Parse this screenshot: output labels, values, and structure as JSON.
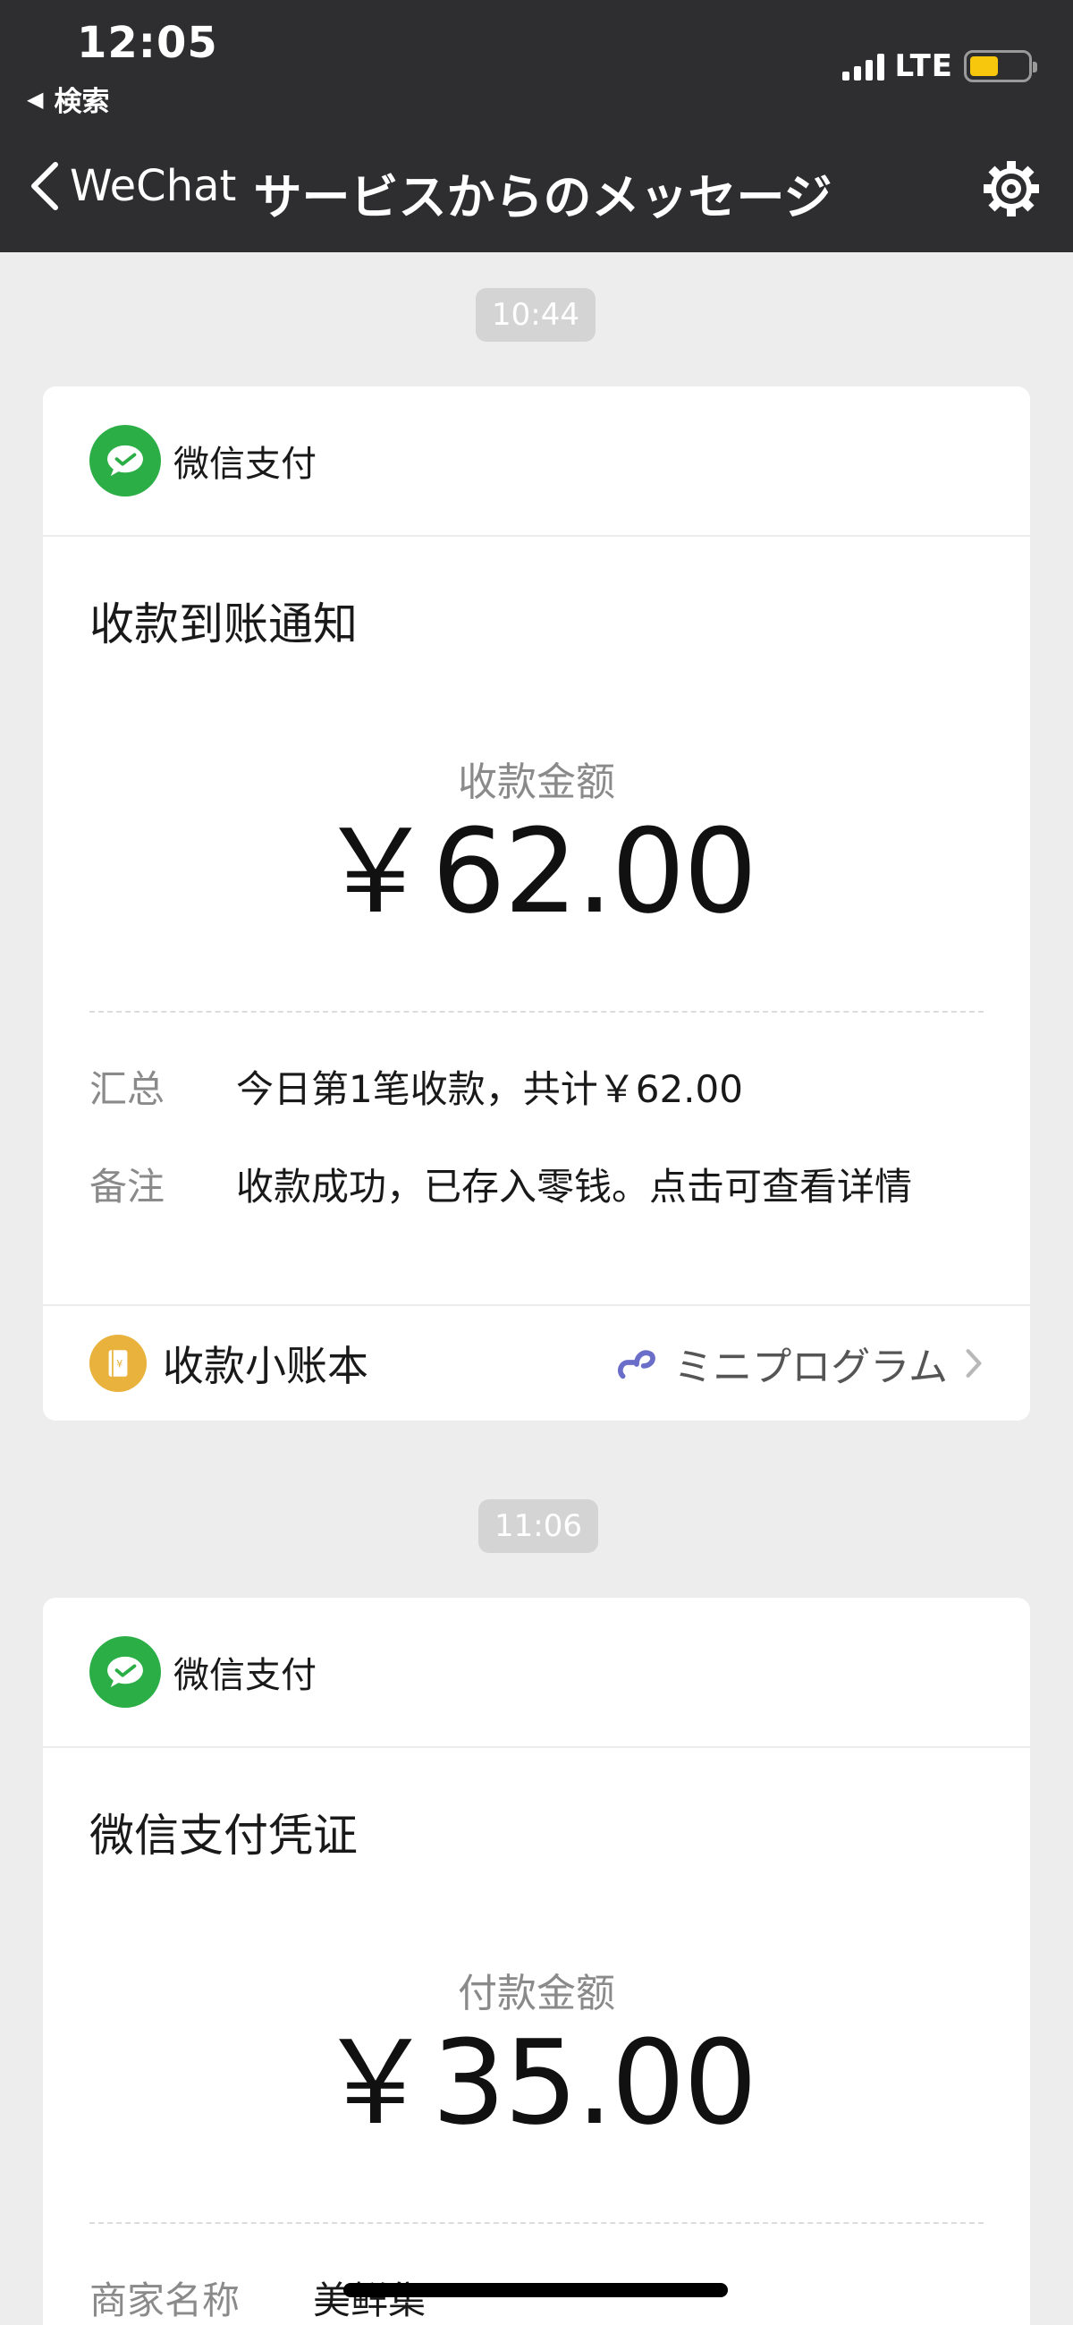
{
  "status_bar": {
    "time": "12:05",
    "back_app": "検索",
    "network": "LTE",
    "battery_level": 0.5
  },
  "nav": {
    "back_label": "WeChat",
    "title": "サービスからのメッセージ",
    "icon": "gear-icon"
  },
  "messages": [
    {
      "time": "10:44",
      "sender": "微信支付",
      "title": "收款到账通知",
      "amount_label": "收款金额",
      "amount": "￥62.00",
      "rows": [
        {
          "key": "汇总",
          "value": "今日第1笔收款，共计￥62.00"
        },
        {
          "key": "备注",
          "value": "收款成功，已存入零钱。点击可查看详情"
        }
      ],
      "footer_label": "收款小账本",
      "footer_link": "ミニプログラム"
    },
    {
      "time": "11:06",
      "sender": "微信支付",
      "title": "微信支付凭证",
      "amount_label": "付款金额",
      "amount": "￥35.00",
      "rows": [
        {
          "key": "商家名称",
          "value": "美鲜集"
        }
      ]
    }
  ],
  "colors": {
    "topbar": "#2e2e30",
    "wechat_pay_green": "#2aae45",
    "ledger_yellow": "#e8b23c",
    "background": "#ededed"
  }
}
